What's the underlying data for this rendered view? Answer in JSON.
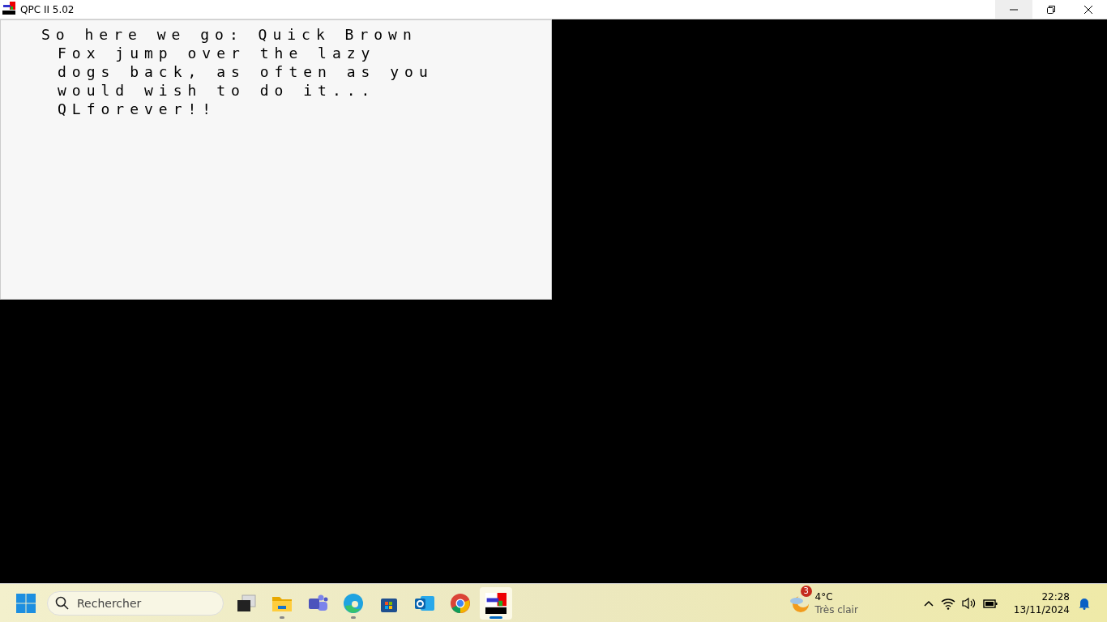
{
  "window": {
    "title": "QPC II 5.02"
  },
  "screen": {
    "lines": [
      "So here we go: Quick Brown",
      "Fox jump over the lazy",
      "dogs back, as often as you",
      "would wish to do it...",
      "QLforever!!"
    ]
  },
  "taskbar": {
    "search": {
      "placeholder": "Rechercher"
    },
    "apps": [
      {
        "kind": "taskview",
        "running": false,
        "selected": false
      },
      {
        "kind": "folder",
        "running": true,
        "selected": false
      },
      {
        "kind": "teams",
        "running": false,
        "selected": false
      },
      {
        "kind": "edge",
        "running": true,
        "selected": false
      },
      {
        "kind": "store",
        "running": false,
        "selected": false
      },
      {
        "kind": "outlook",
        "running": false,
        "selected": false
      },
      {
        "kind": "chrome",
        "running": false,
        "selected": false
      },
      {
        "kind": "qpc",
        "running": true,
        "selected": true
      }
    ],
    "weather": {
      "badge": "3",
      "temperature": "4°C",
      "condition": "Très clair"
    },
    "clock": {
      "time": "22:28",
      "date": "13/11/2024"
    }
  }
}
